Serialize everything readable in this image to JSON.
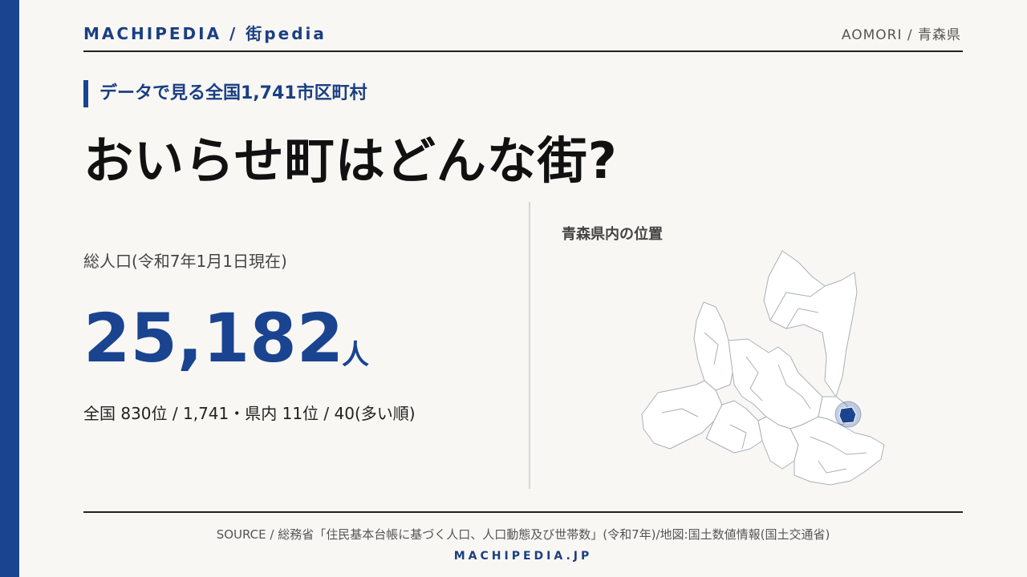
{
  "header": {
    "brand": "MACHIPEDIA / 街pedia",
    "region": "AOMORI / 青森県"
  },
  "hero": {
    "kicker": "データで見る全国1,741市区町村",
    "title": "おいらせ町はどんな街?"
  },
  "stats": {
    "label": "総人口(令和7年1月1日現在)",
    "value": "25,182",
    "unit": "人",
    "rank": "全国 830位 / 1,741・県内 11位 / 40(多い順)"
  },
  "map": {
    "title": "青森県内の位置"
  },
  "footer": {
    "source": "SOURCE / 総務省「住民基本台帳に基づく人口、人口動態及び世帯数」(令和7年)/地図:国土数値情報(国土交通省)",
    "site": "MACHIPEDIA.JP"
  },
  "colors": {
    "accent": "#1a4490",
    "background": "#f9f7f4",
    "highlight": "#1a4490"
  }
}
